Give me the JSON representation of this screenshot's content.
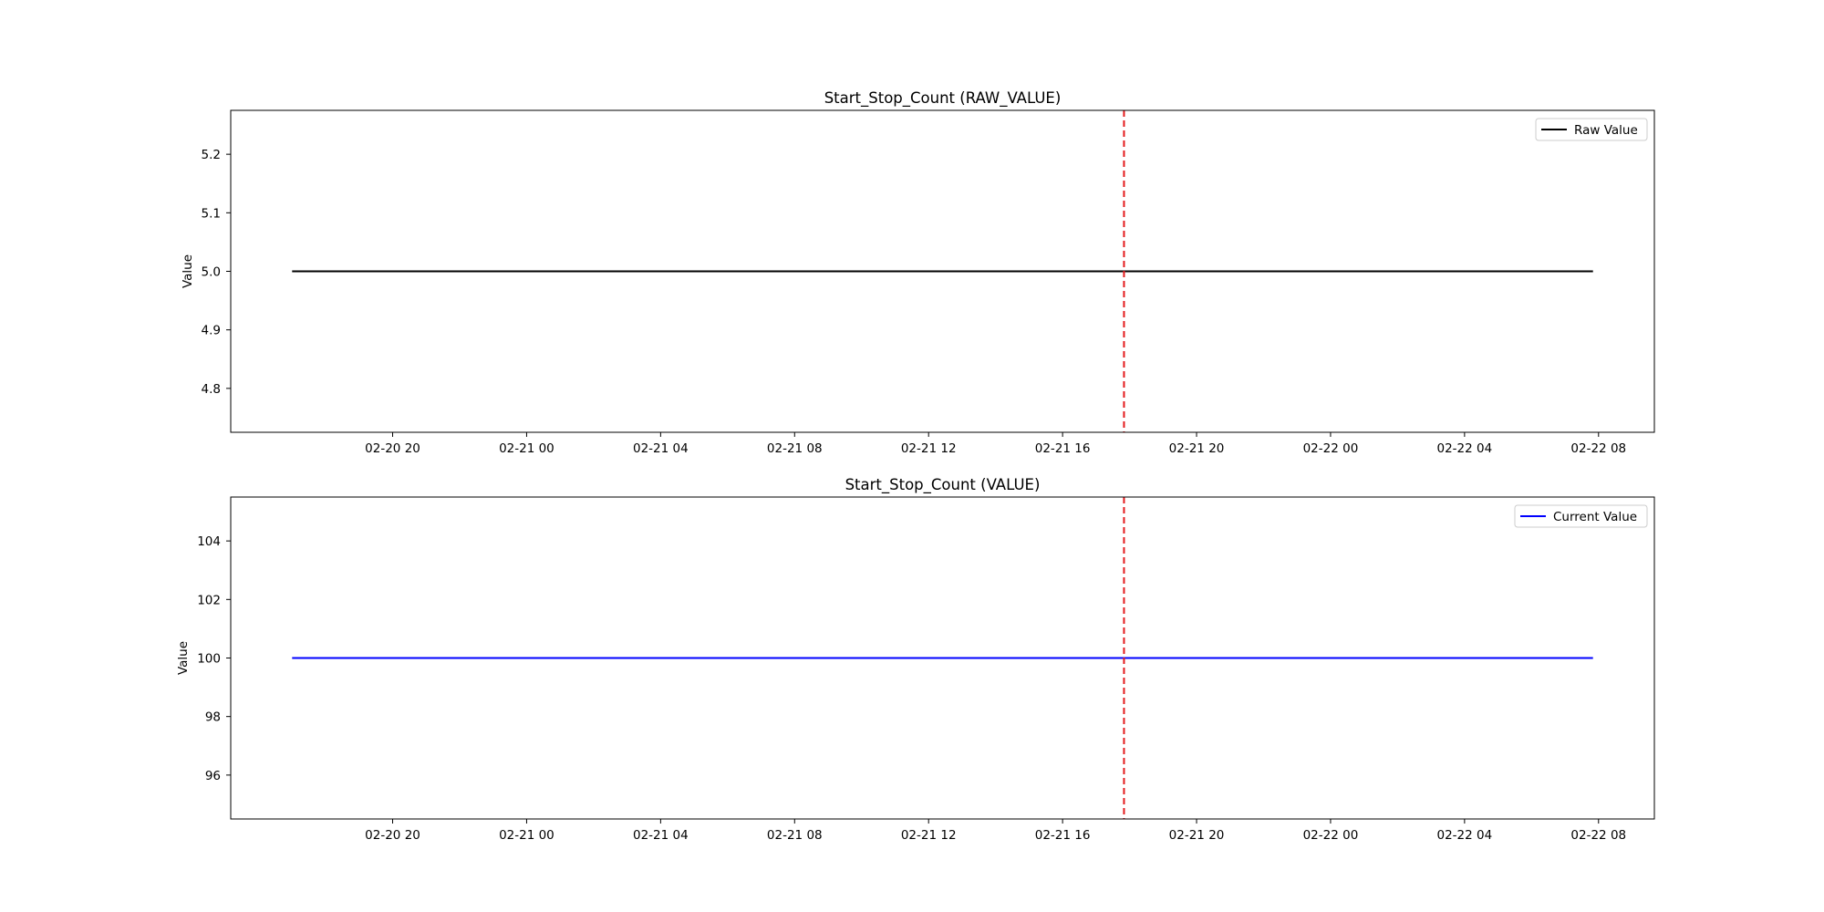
{
  "chart_data": [
    {
      "type": "line",
      "title": "Start_Stop_Count (RAW_VALUE)",
      "xlabel": "",
      "ylabel": "Value",
      "x_start": "2025-02-20 17:00",
      "x_end": "2025-02-22 07:50",
      "xlim": [
        "2025-02-20 15:10",
        "2025-02-22 09:40"
      ],
      "ylim": [
        4.725,
        5.275
      ],
      "yticks": [
        4.8,
        4.9,
        5.0,
        5.1,
        5.2
      ],
      "ytick_labels": [
        "4.8",
        "4.9",
        "5.0",
        "5.1",
        "5.2"
      ],
      "xticks": [
        "2025-02-20 20:00",
        "2025-02-21 00:00",
        "2025-02-21 04:00",
        "2025-02-21 08:00",
        "2025-02-21 12:00",
        "2025-02-21 16:00",
        "2025-02-21 20:00",
        "2025-02-22 00:00",
        "2025-02-22 04:00",
        "2025-02-22 08:00"
      ],
      "xtick_labels": [
        "02-20 20",
        "02-21 00",
        "02-21 04",
        "02-21 08",
        "02-21 12",
        "02-21 16",
        "02-21 20",
        "02-22 00",
        "02-22 04",
        "02-22 08"
      ],
      "series": [
        {
          "name": "Raw Value",
          "color": "#000000",
          "x": [
            "2025-02-20 17:00",
            "2025-02-22 07:50"
          ],
          "y": [
            5,
            5
          ]
        }
      ],
      "vline": {
        "x": "2025-02-21 17:50",
        "color": "#e41a1c",
        "style": "dashed"
      },
      "legend": "top-right",
      "grid": false
    },
    {
      "type": "line",
      "title": "Start_Stop_Count (VALUE)",
      "xlabel": "",
      "ylabel": "Value",
      "x_start": "2025-02-20 17:00",
      "x_end": "2025-02-22 07:50",
      "xlim": [
        "2025-02-20 15:10",
        "2025-02-22 09:40"
      ],
      "ylim": [
        94.5,
        105.5
      ],
      "yticks": [
        96,
        98,
        100,
        102,
        104
      ],
      "ytick_labels": [
        "96",
        "98",
        "100",
        "102",
        "104"
      ],
      "xticks": [
        "2025-02-20 20:00",
        "2025-02-21 00:00",
        "2025-02-21 04:00",
        "2025-02-21 08:00",
        "2025-02-21 12:00",
        "2025-02-21 16:00",
        "2025-02-21 20:00",
        "2025-02-22 00:00",
        "2025-02-22 04:00",
        "2025-02-22 08:00"
      ],
      "xtick_labels": [
        "02-20 20",
        "02-21 00",
        "02-21 04",
        "02-21 08",
        "02-21 12",
        "02-21 16",
        "02-21 20",
        "02-22 00",
        "02-22 04",
        "02-22 08"
      ],
      "series": [
        {
          "name": "Current Value",
          "color": "#0000ff",
          "x": [
            "2025-02-20 17:00",
            "2025-02-22 07:50"
          ],
          "y": [
            100,
            100
          ]
        }
      ],
      "vline": {
        "x": "2025-02-21 17:50",
        "color": "#e41a1c",
        "style": "dashed"
      },
      "legend": "top-right",
      "grid": false
    }
  ]
}
